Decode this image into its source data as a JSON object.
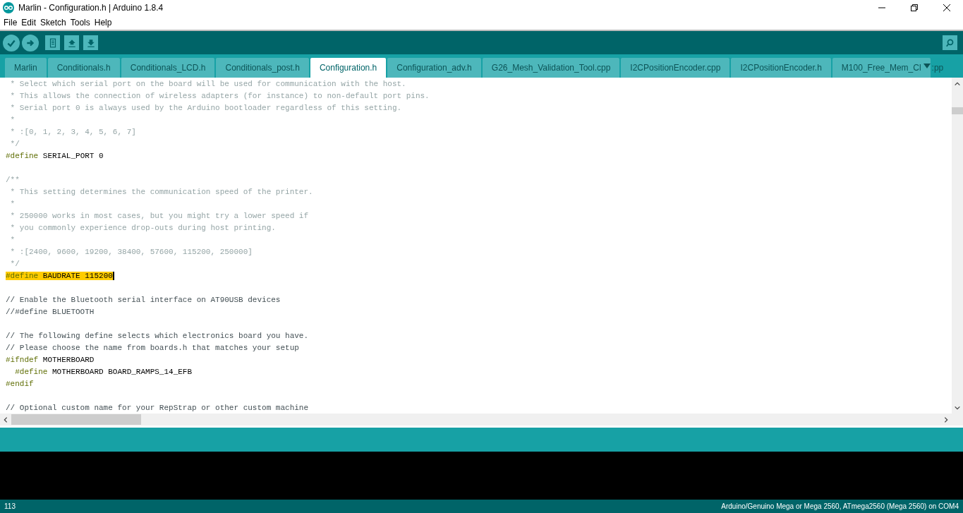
{
  "window": {
    "title": "Marlin - Configuration.h | Arduino 1.8.4"
  },
  "menu": [
    "File",
    "Edit",
    "Sketch",
    "Tools",
    "Help"
  ],
  "tabs": [
    {
      "label": "Marlin",
      "selected": false
    },
    {
      "label": "Conditionals.h",
      "selected": false
    },
    {
      "label": "Conditionals_LCD.h",
      "selected": false
    },
    {
      "label": "Conditionals_post.h",
      "selected": false
    },
    {
      "label": "Configuration.h",
      "selected": true
    },
    {
      "label": "Configuration_adv.h",
      "selected": false
    },
    {
      "label": "G26_Mesh_Validation_Tool.cpp",
      "selected": false
    },
    {
      "label": "I2CPositionEncoder.cpp",
      "selected": false
    },
    {
      "label": "I2CPositionEncoder.h",
      "selected": false
    },
    {
      "label": "M100_Free_Mem_Cl",
      "selected": false
    }
  ],
  "tab_overflow_tail": ":pp",
  "editor": {
    "lines": [
      {
        "kind": "comment",
        "text": " * Select which serial port on the board will be used for communication with the host."
      },
      {
        "kind": "comment",
        "text": " * This allows the connection of wireless adapters (for instance) to non-default port pins."
      },
      {
        "kind": "comment",
        "text": " * Serial port 0 is always used by the Arduino bootloader regardless of this setting."
      },
      {
        "kind": "comment",
        "text": " *"
      },
      {
        "kind": "comment",
        "text": " * :[0, 1, 2, 3, 4, 5, 6, 7]"
      },
      {
        "kind": "comment",
        "text": " */"
      },
      {
        "kind": "code",
        "keyword": "#define",
        "text": "SERIAL_PORT 0",
        "highlighted": false
      },
      {
        "kind": "blank"
      },
      {
        "kind": "comment",
        "text": "/**"
      },
      {
        "kind": "comment",
        "text": " * This setting determines the communication speed of the printer."
      },
      {
        "kind": "comment",
        "text": " *"
      },
      {
        "kind": "comment",
        "text": " * 250000 works in most cases, but you might try a lower speed if"
      },
      {
        "kind": "comment",
        "text": " * you commonly experience drop-outs during host printing."
      },
      {
        "kind": "comment",
        "text": " *"
      },
      {
        "kind": "comment",
        "text": " * :[2400, 9600, 19200, 38400, 57600, 115200, 250000]"
      },
      {
        "kind": "comment",
        "text": " */"
      },
      {
        "kind": "code",
        "keyword": "#define",
        "text": "BAUDRATE 115200",
        "highlighted": true
      },
      {
        "kind": "blank"
      },
      {
        "kind": "line_comment",
        "text": "// Enable the Bluetooth serial interface on AT90USB devices"
      },
      {
        "kind": "line_comment",
        "text": "//#define BLUETOOTH"
      },
      {
        "kind": "blank"
      },
      {
        "kind": "line_comment",
        "text": "// The following define selects which electronics board you have."
      },
      {
        "kind": "line_comment",
        "text": "// Please choose the name from boards.h that matches your setup"
      },
      {
        "kind": "code",
        "keyword": "#ifndef",
        "text": "MOTHERBOARD",
        "highlighted": false
      },
      {
        "kind": "code",
        "keyword": "  #define",
        "text": "MOTHERBOARD BOARD_RAMPS_14_EFB",
        "highlighted": false
      },
      {
        "kind": "code",
        "keyword": "#endif",
        "highlighted": false
      },
      {
        "kind": "blank"
      },
      {
        "kind": "line_comment",
        "text": "// Optional custom name for your RepStrap or other custom machine"
      }
    ]
  },
  "status_bar": {
    "line": "113",
    "board": "Arduino/Genuino Mega or Mega 2560, ATmega2560 (Mega 2560) on COM4"
  }
}
